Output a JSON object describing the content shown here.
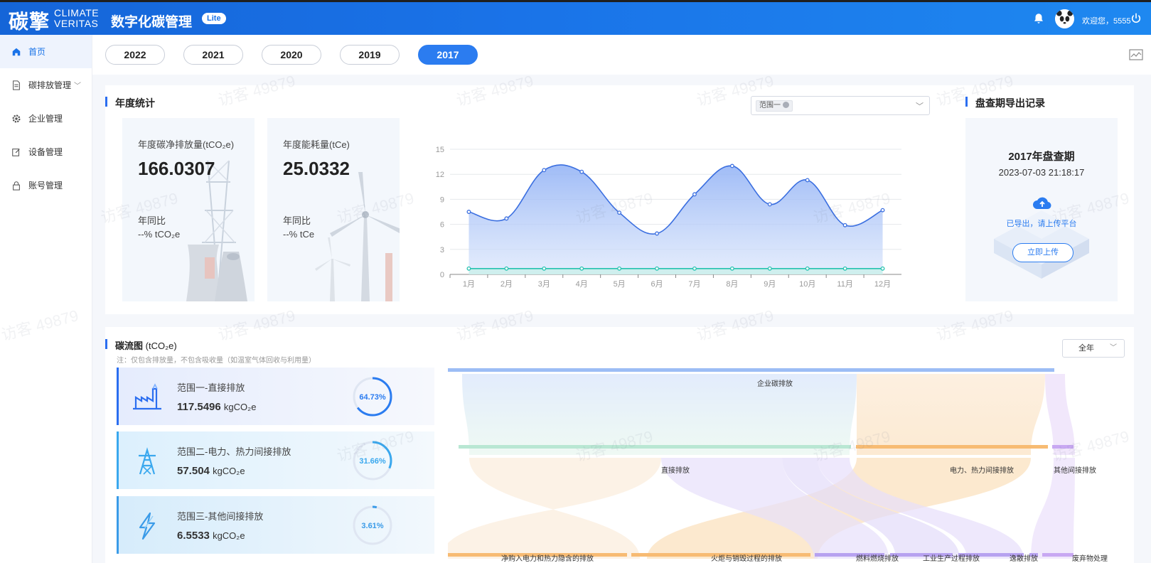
{
  "header": {
    "logo_cn": "碳擎",
    "logo_en_line1": "CLIMATE",
    "logo_en_line2": "VERITAS",
    "app_title": "数字化碳管理",
    "badge": "Lite",
    "welcome": "欢迎您，5555"
  },
  "sidebar": {
    "items": [
      {
        "label": "首页",
        "icon": "home-icon"
      },
      {
        "label": "碳排放管理",
        "icon": "document-icon"
      },
      {
        "label": "企业管理",
        "icon": "gear-icon"
      },
      {
        "label": "设备管理",
        "icon": "edit-icon"
      },
      {
        "label": "账号管理",
        "icon": "lock-icon"
      }
    ]
  },
  "years": [
    "2022",
    "2021",
    "2020",
    "2019",
    "2017"
  ],
  "selected_year": "2017",
  "annual": {
    "title": "年度统计",
    "scope_filter_tag": "范围一",
    "carbon": {
      "label": "年度碳净排放量(tCO₂e)",
      "value": "166.0307",
      "yoy_label": "年同比",
      "yoy_value": "--%  tCO₂e"
    },
    "energy": {
      "label": "年度能耗量(tCe)",
      "value": "25.0332",
      "yoy_label": "年同比",
      "yoy_value": "--%  tCe"
    }
  },
  "chart_data": {
    "type": "area",
    "categories": [
      "1月",
      "2月",
      "3月",
      "4月",
      "5月",
      "6月",
      "7月",
      "8月",
      "9月",
      "10月",
      "11月",
      "12月"
    ],
    "series": [
      {
        "values": [
          7.5,
          6.7,
          12.5,
          12.3,
          7.4,
          4.9,
          9.6,
          13.0,
          8.4,
          11.3,
          5.9,
          7.7
        ],
        "color": "#3b6fe0"
      },
      {
        "values": [
          0.7,
          0.7,
          0.7,
          0.7,
          0.7,
          0.7,
          0.7,
          0.7,
          0.7,
          0.7,
          0.7,
          0.7
        ],
        "color": "#26c2b0"
      }
    ],
    "y_ticks": [
      "0",
      "3",
      "6",
      "9",
      "12",
      "15"
    ],
    "ylim": [
      0,
      15
    ],
    "grid": true
  },
  "export": {
    "title": "盘查期导出记录",
    "period": "2017年盘查期",
    "time": "2023-07-03 21:18:17",
    "status": "已导出，请上传平台",
    "button": "立即上传"
  },
  "flow": {
    "title": "碳流图",
    "unit": "(tCO₂e)",
    "note": "注：仅包含排放量，不包含吸收量（如温室气体回收与利用量）",
    "period": "全年",
    "scopes": [
      {
        "name": "范围一-直接排放",
        "value": "117.5496",
        "unit": "kgCO₂e",
        "percent": "64.73%",
        "fraction": 0.6473,
        "color": "#2b7cf0",
        "icon": "factory-icon"
      },
      {
        "name": "范围二-电力、热力间接排放",
        "value": "57.504",
        "unit": "kgCO₂e",
        "percent": "31.66%",
        "fraction": 0.3166,
        "color": "#3aa8ee",
        "icon": "power-tower-icon"
      },
      {
        "name": "范围三-其他间接排放",
        "value": "6.5533",
        "unit": "kgCO₂e",
        "percent": "3.61%",
        "fraction": 0.0361,
        "color": "#3a9be8",
        "icon": "lightning-icon"
      }
    ],
    "sankey": {
      "root": "企业碳排放",
      "level2": [
        "直接排放",
        "电力、热力间接排放",
        "其他间接排放"
      ],
      "level3": [
        "净购入电力和热力隐含的排放",
        "火炬与销毁过程的排放",
        "燃料燃烧排放",
        "工业生产过程排放",
        "逸散排放",
        "废弃物处理"
      ]
    }
  },
  "watermark": "访客 49879",
  "colors": {
    "primary": "#2b7cf0",
    "header": "#1a73e8"
  }
}
